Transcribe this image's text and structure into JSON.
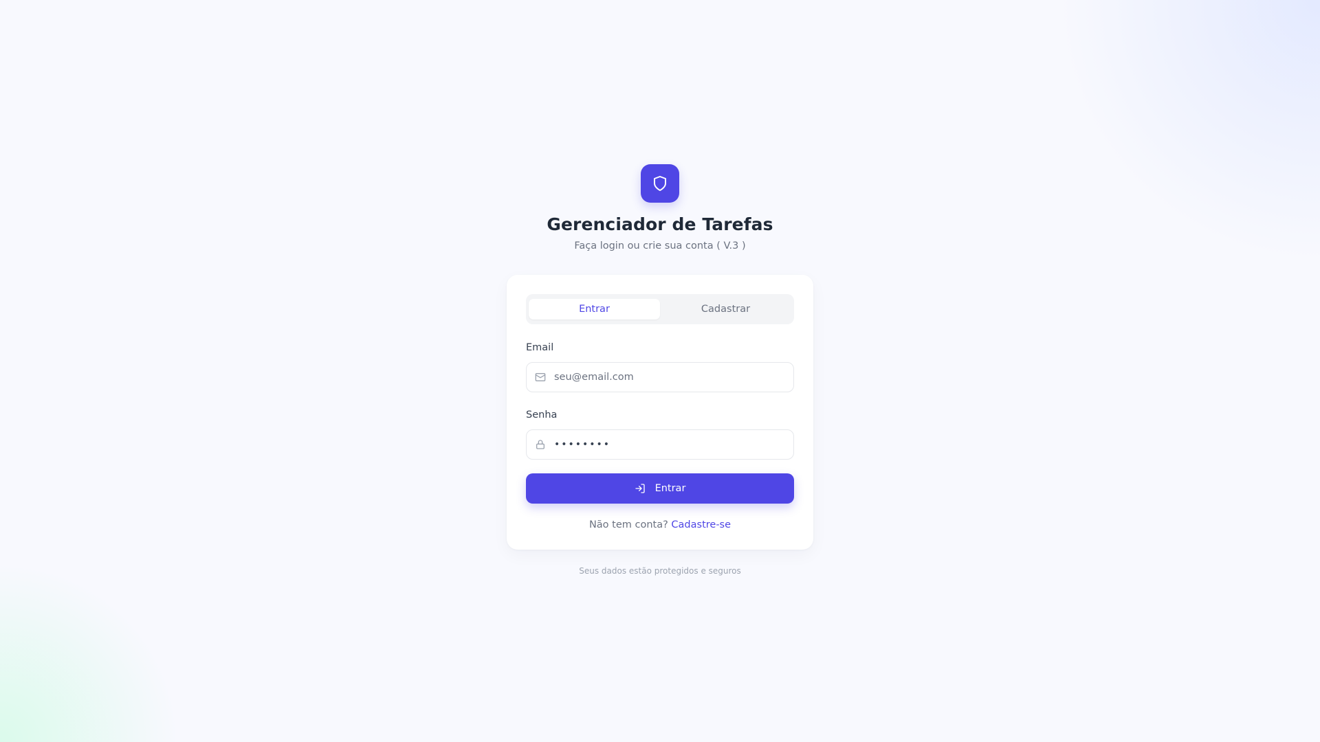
{
  "brand": {
    "icon": "shield-icon",
    "title": "Gerenciador de Tarefas",
    "subtitle": "Faça login ou crie sua conta ( V.3 )"
  },
  "tabs": [
    {
      "label": "Entrar",
      "active": true
    },
    {
      "label": "Cadastrar",
      "active": false
    }
  ],
  "form": {
    "email": {
      "label": "Email",
      "placeholder": "seu@email.com",
      "value": "",
      "icon": "mail-icon"
    },
    "password": {
      "label": "Senha",
      "value": "••••••••",
      "icon": "lock-icon"
    },
    "submit": {
      "label": "Entrar",
      "icon": "log-in-icon"
    }
  },
  "switch_prompt": {
    "text": "Não tem conta?",
    "link": "Cadastre-se"
  },
  "footer": "Seus dados estão protegidos e seguros",
  "colors": {
    "accent": "#4f46e5",
    "background": "#f8f9fe",
    "text_primary": "#1f2937",
    "text_muted": "#6b7280"
  }
}
